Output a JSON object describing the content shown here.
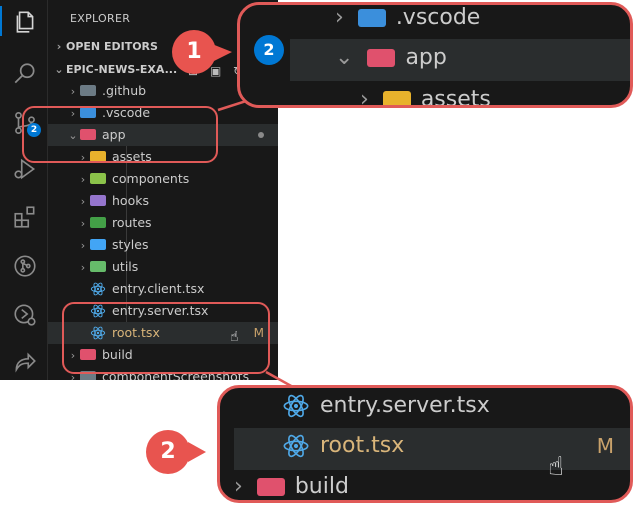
{
  "explorer": {
    "title": "EXPLORER",
    "open_editors": "OPEN EDITORS",
    "project": "EPIC-NEWS-EXA...",
    "scm_badge": "2",
    "items": [
      {
        "name": ".github",
        "kind": "folder",
        "color": "#6c7b85"
      },
      {
        "name": ".vscode",
        "kind": "folder",
        "color": "#3b8fdc"
      },
      {
        "name": "app",
        "kind": "folder-open",
        "color": "#e0516d",
        "status": "•"
      },
      {
        "name": "assets",
        "kind": "folder",
        "color": "#e8b22c"
      },
      {
        "name": "components",
        "kind": "folder",
        "color": "#8bc34a"
      },
      {
        "name": "hooks",
        "kind": "folder",
        "color": "#9575cd"
      },
      {
        "name": "routes",
        "kind": "folder",
        "color": "#43a047"
      },
      {
        "name": "styles",
        "kind": "folder",
        "color": "#42a5f5"
      },
      {
        "name": "utils",
        "kind": "folder",
        "color": "#66bb6a"
      },
      {
        "name": "entry.client.tsx",
        "kind": "react"
      },
      {
        "name": "entry.server.tsx",
        "kind": "react"
      },
      {
        "name": "root.tsx",
        "kind": "react",
        "status": "M"
      },
      {
        "name": "build",
        "kind": "folder",
        "color": "#e0516d"
      },
      {
        "name": "componentScreenshots",
        "kind": "folder",
        "color": "#6c7b85"
      }
    ]
  },
  "callouts": {
    "marker1": "1",
    "marker2": "2",
    "zoom1": {
      "badge": "2",
      "rows": [
        ".vscode",
        "app",
        "assets"
      ]
    },
    "zoom2": {
      "rows": [
        "entry.server.tsx",
        "root.tsx",
        "build"
      ],
      "status": "M"
    }
  },
  "colors": {
    "accent": "#0078d4",
    "callout": "#e05a58",
    "modified": "#c9a26b",
    "react": "#4fa9e8"
  },
  "icons": [
    "files-icon",
    "search-icon",
    "source-control-icon",
    "run-debug-icon",
    "extensions-icon",
    "git-graph-icon",
    "remote-icon",
    "share-icon",
    "react-icon"
  ]
}
